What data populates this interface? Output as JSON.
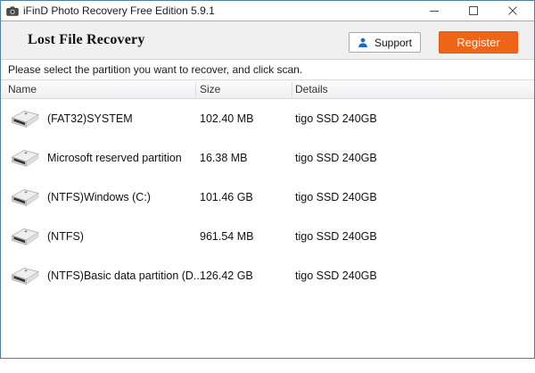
{
  "window": {
    "title": "iFinD Photo Recovery Free Edition 5.9.1"
  },
  "header": {
    "title": "Lost File Recovery",
    "support_button": "Support",
    "register_button": "Register"
  },
  "instruction_text": "Please select the partition you want to recover, and click scan.",
  "partition_table": {
    "columns": [
      "Name",
      "Size",
      "Details"
    ],
    "rows": [
      {
        "name": "(FAT32)SYSTEM",
        "size": "102.40 MB",
        "details": "tigo SSD 240GB"
      },
      {
        "name": "Microsoft reserved partition",
        "size": "16.38 MB",
        "details": "tigo SSD 240GB"
      },
      {
        "name": "(NTFS)Windows (C:)",
        "size": "101.46 GB",
        "details": "tigo SSD 240GB"
      },
      {
        "name": "(NTFS)",
        "size": "961.54 MB",
        "details": "tigo SSD 240GB"
      },
      {
        "name": "(NTFS)Basic data partition (D...",
        "size": "126.42 GB",
        "details": "tigo SSD 240GB"
      }
    ]
  },
  "colors": {
    "register_orange": "#f06418",
    "window_border": "#4f81a5",
    "support_icon_blue": "#1f68c5",
    "header_background": "#f0f0f0"
  }
}
